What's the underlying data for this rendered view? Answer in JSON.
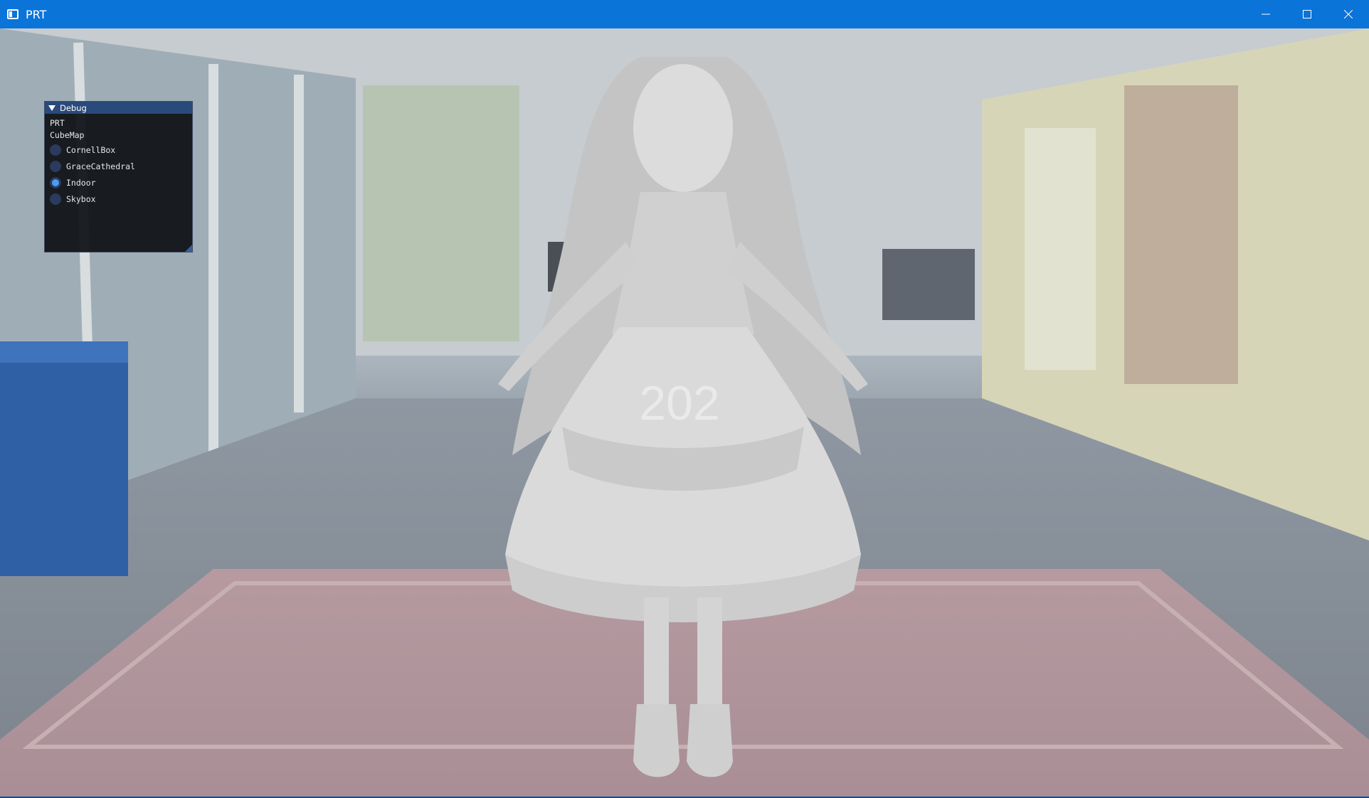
{
  "window": {
    "title": "PRT",
    "controls": {
      "minimize": "minimize-icon",
      "maximize": "maximize-icon",
      "close": "close-icon"
    }
  },
  "debug_panel": {
    "header": "Debug",
    "lines": [
      "PRT",
      "CubeMap"
    ],
    "options": [
      {
        "label": "CornellBox",
        "selected": false
      },
      {
        "label": "GraceCathedral",
        "selected": false
      },
      {
        "label": "Indoor",
        "selected": true
      },
      {
        "label": "Skybox",
        "selected": false
      }
    ]
  },
  "scene": {
    "model_label": "202"
  },
  "colors": {
    "titlebar": "#0a74d9",
    "panel_header": "#294a7a",
    "radio_selected": "#4a9cf5"
  }
}
